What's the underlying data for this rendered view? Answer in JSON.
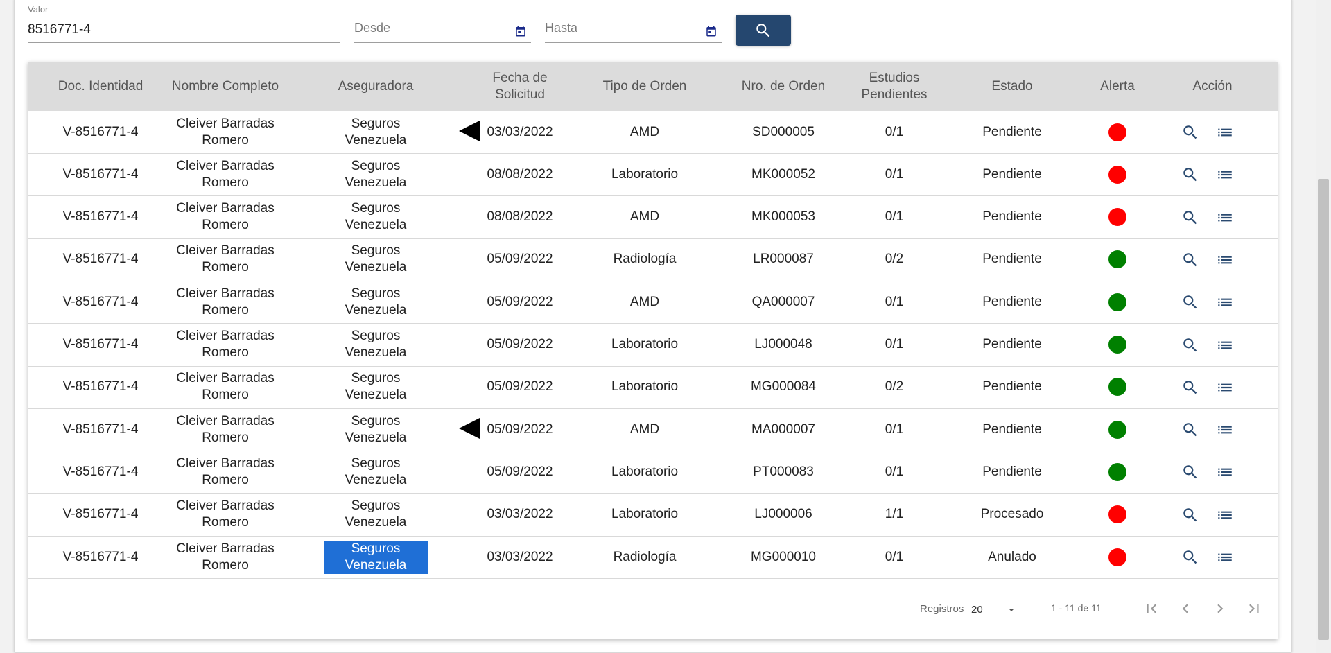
{
  "filters": {
    "valor_label": "Valor",
    "valor_value": "8516771-4",
    "desde_placeholder": "Desde",
    "hasta_placeholder": "Hasta"
  },
  "table": {
    "headers": {
      "doc": "Doc. Identidad",
      "nombre": "Nombre Completo",
      "aseguradora": "Aseguradora",
      "fecha": "Fecha de Solicitud",
      "tipo": "Tipo de Orden",
      "nro": "Nro. de Orden",
      "estudios": "Estudios Pendientes",
      "estado": "Estado",
      "alerta": "Alerta",
      "accion": "Acción"
    },
    "rows": [
      {
        "doc": "V-8516771-4",
        "nombre": "Cleiver Barradas Romero",
        "aseguradora": "Seguros Venezuela",
        "fecha": "03/03/2022",
        "tipo": "AMD",
        "nro": "SD000005",
        "estudios": "0/1",
        "estado": "Pendiente",
        "alerta": "red"
      },
      {
        "doc": "V-8516771-4",
        "nombre": "Cleiver Barradas Romero",
        "aseguradora": "Seguros Venezuela",
        "fecha": "08/08/2022",
        "tipo": "Laboratorio",
        "nro": "MK000052",
        "estudios": "0/1",
        "estado": "Pendiente",
        "alerta": "red"
      },
      {
        "doc": "V-8516771-4",
        "nombre": "Cleiver Barradas Romero",
        "aseguradora": "Seguros Venezuela",
        "fecha": "08/08/2022",
        "tipo": "AMD",
        "nro": "MK000053",
        "estudios": "0/1",
        "estado": "Pendiente",
        "alerta": "red"
      },
      {
        "doc": "V-8516771-4",
        "nombre": "Cleiver Barradas Romero",
        "aseguradora": "Seguros Venezuela",
        "fecha": "05/09/2022",
        "tipo": "Radiología",
        "nro": "LR000087",
        "estudios": "0/2",
        "estado": "Pendiente",
        "alerta": "green"
      },
      {
        "doc": "V-8516771-4",
        "nombre": "Cleiver Barradas Romero",
        "aseguradora": "Seguros Venezuela",
        "fecha": "05/09/2022",
        "tipo": "AMD",
        "nro": "QA000007",
        "estudios": "0/1",
        "estado": "Pendiente",
        "alerta": "green"
      },
      {
        "doc": "V-8516771-4",
        "nombre": "Cleiver Barradas Romero",
        "aseguradora": "Seguros Venezuela",
        "fecha": "05/09/2022",
        "tipo": "Laboratorio",
        "nro": "LJ000048",
        "estudios": "0/1",
        "estado": "Pendiente",
        "alerta": "green"
      },
      {
        "doc": "V-8516771-4",
        "nombre": "Cleiver Barradas Romero",
        "aseguradora": "Seguros Venezuela",
        "fecha": "05/09/2022",
        "tipo": "Laboratorio",
        "nro": "MG000084",
        "estudios": "0/2",
        "estado": "Pendiente",
        "alerta": "green"
      },
      {
        "doc": "V-8516771-4",
        "nombre": "Cleiver Barradas Romero",
        "aseguradora": "Seguros Venezuela",
        "fecha": "05/09/2022",
        "tipo": "AMD",
        "nro": "MA000007",
        "estudios": "0/1",
        "estado": "Pendiente",
        "alerta": "green"
      },
      {
        "doc": "V-8516771-4",
        "nombre": "Cleiver Barradas Romero",
        "aseguradora": "Seguros Venezuela",
        "fecha": "05/09/2022",
        "tipo": "Laboratorio",
        "nro": "PT000083",
        "estudios": "0/1",
        "estado": "Pendiente",
        "alerta": "green"
      },
      {
        "doc": "V-8516771-4",
        "nombre": "Cleiver Barradas Romero",
        "aseguradora": "Seguros Venezuela",
        "fecha": "03/03/2022",
        "tipo": "Laboratorio",
        "nro": "LJ000006",
        "estudios": "1/1",
        "estado": "Procesado",
        "alerta": "red"
      },
      {
        "doc": "V-8516771-4",
        "nombre": "Cleiver Barradas Romero",
        "aseguradora": "Seguros Venezuela",
        "fecha": "03/03/2022",
        "tipo": "Radiología",
        "nro": "MG000010",
        "estudios": "0/1",
        "estado": "Anulado",
        "alerta": "red"
      }
    ]
  },
  "pagination": {
    "registros_label": "Registros",
    "page_size": "20",
    "range_text": "1 - 11 de 11"
  },
  "colors": {
    "primary": "#25476f",
    "alert_red": "#ff0000",
    "alert_green": "#008000",
    "icon_blue": "#2a4a70",
    "selection": "#1f6fd6"
  }
}
